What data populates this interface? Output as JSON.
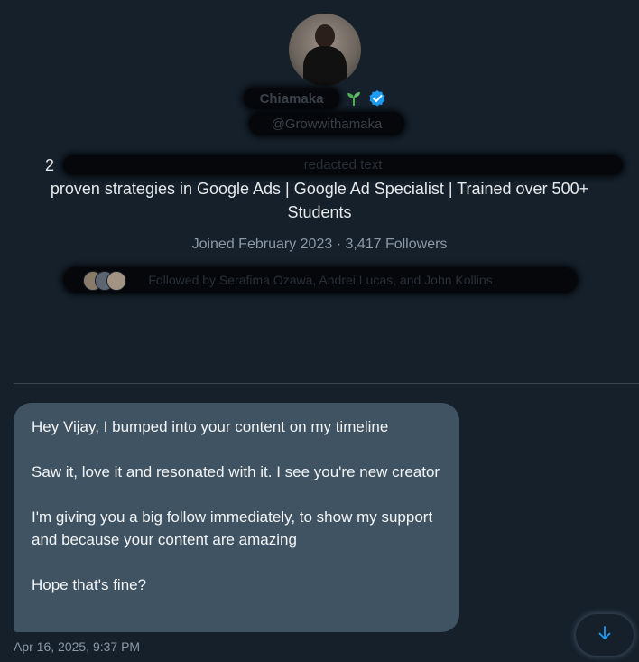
{
  "profile": {
    "name_redacted": "Chiamaka",
    "handle_redacted": "@Growwithamaka",
    "bio_line1_start": "2",
    "bio_line1_redacted": "redacted text",
    "bio_rest": "proven strategies in Google Ads | Google Ad Specialist | Trained over 500+ Students",
    "joined": "Joined February 2023",
    "separator": "·",
    "followers": "3,417 Followers",
    "followed_by_redacted": "Followed by Serafima Ozawa, Andrei Lucas, and John Kollins",
    "colors": {
      "verified": "#1d9bf0",
      "sprout": "#4caf50"
    }
  },
  "conversation": {
    "message": {
      "paragraphs": [
        "Hey Vijay, I bumped into your content on my timeline",
        "Saw it, love it and resonated with it. I see you're new creator",
        "I'm giving you a big follow immediately, to show my support and because your content are amazing",
        "Hope that's fine?"
      ],
      "timestamp": "Apr 16, 2025, 9:37 PM"
    },
    "scroll_button_icon": "arrow-down-icon"
  }
}
